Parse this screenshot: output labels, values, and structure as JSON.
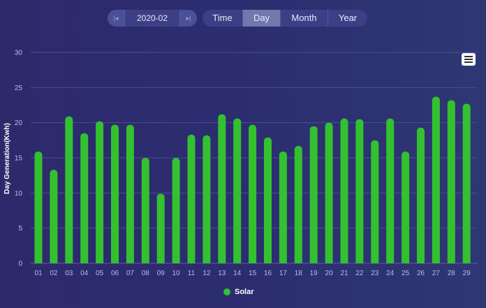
{
  "toolbar": {
    "date_value": "2020-02",
    "prev_icon": "step-back-icon",
    "next_icon": "step-forward-icon",
    "tabs": [
      {
        "label": "Time",
        "active": false
      },
      {
        "label": "Day",
        "active": true
      },
      {
        "label": "Month",
        "active": false
      },
      {
        "label": "Year",
        "active": false
      }
    ]
  },
  "menu_icon": "hamburger-menu-icon",
  "legend": {
    "label": "Solar"
  },
  "colors": {
    "bar": "#33c12f",
    "axis_text": "#b9bde6",
    "grid": "#4a4e95",
    "active_tab": "#7277ac"
  },
  "chart_data": {
    "type": "bar",
    "title": "",
    "xlabel": "",
    "ylabel": "Day Generation(Kwh)",
    "ylim": [
      0,
      30
    ],
    "yticks": [
      0,
      5,
      10,
      15,
      20,
      25,
      30
    ],
    "grid": true,
    "legend_position": "bottom-center",
    "categories": [
      "01",
      "02",
      "03",
      "04",
      "05",
      "06",
      "07",
      "08",
      "09",
      "10",
      "11",
      "12",
      "13",
      "14",
      "15",
      "16",
      "17",
      "18",
      "19",
      "20",
      "21",
      "22",
      "23",
      "24",
      "25",
      "26",
      "27",
      "28",
      "29"
    ],
    "series": [
      {
        "name": "Solar",
        "values": [
          15.9,
          13.3,
          20.9,
          18.5,
          20.2,
          19.7,
          19.7,
          15.0,
          9.9,
          15.0,
          18.3,
          18.2,
          21.2,
          20.6,
          19.7,
          17.9,
          15.9,
          16.7,
          19.5,
          20.0,
          20.6,
          20.5,
          17.5,
          20.6,
          15.9,
          19.3,
          23.7,
          23.2,
          22.7
        ]
      }
    ]
  }
}
